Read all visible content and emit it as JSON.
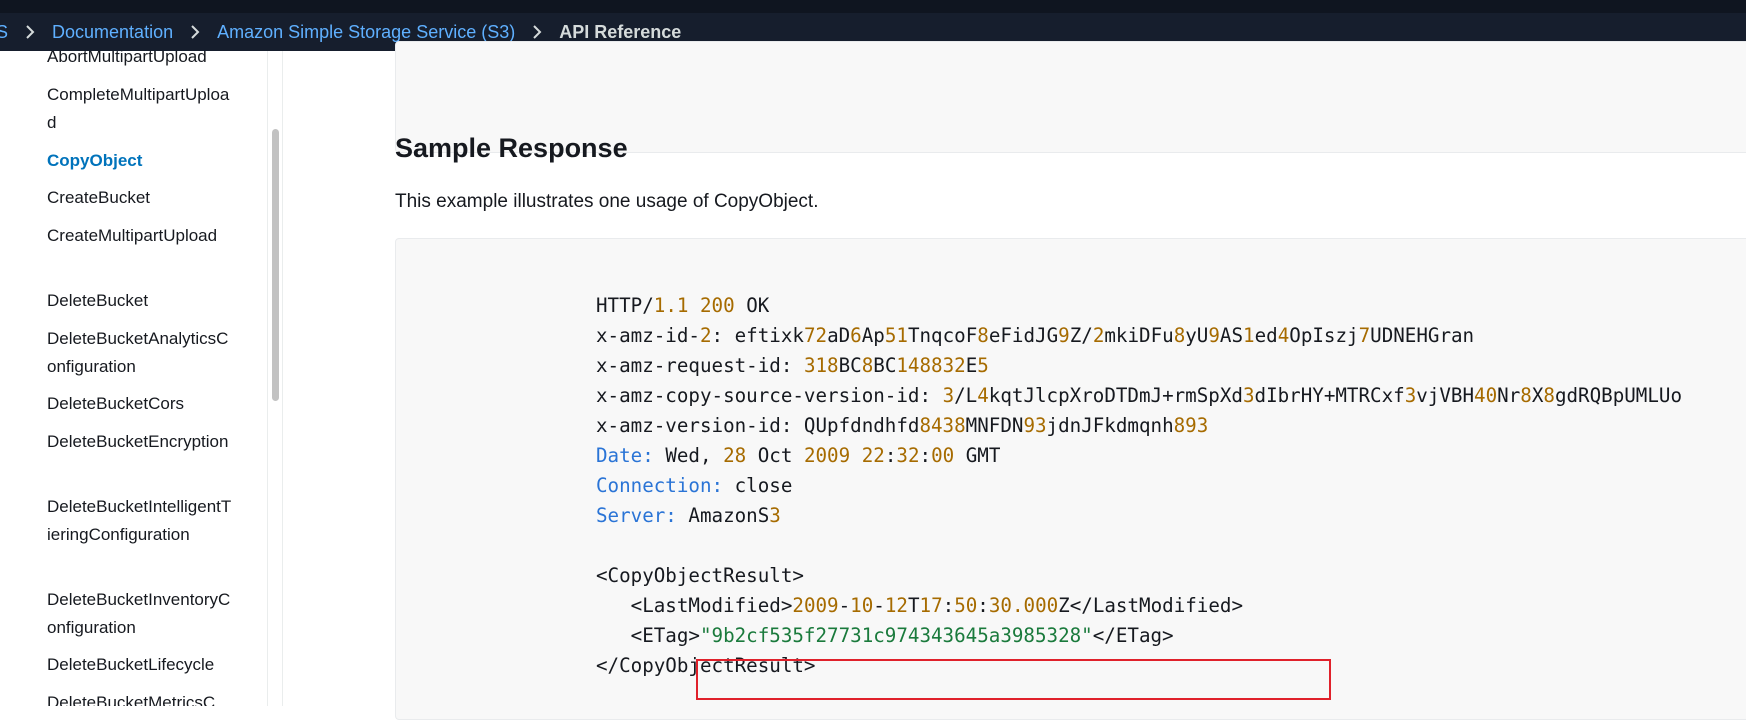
{
  "breadcrumb": {
    "items": [
      "S",
      "Documentation",
      "Amazon Simple Storage Service (S3)"
    ],
    "current": "API Reference"
  },
  "sidebar": {
    "items": [
      {
        "label": "AbortMultipartUpload",
        "active": false
      },
      {
        "label": "CompleteMultipartUpload",
        "active": false
      },
      {
        "label": "CopyObject",
        "active": true
      },
      {
        "label": "CreateBucket",
        "active": false
      },
      {
        "label": "CreateMultipartUpload",
        "active": false
      },
      {
        "label": "DeleteBucket",
        "active": false
      },
      {
        "label": "DeleteBucketAnalyticsConfiguration",
        "active": false
      },
      {
        "label": "DeleteBucketCors",
        "active": false
      },
      {
        "label": "DeleteBucketEncryption",
        "active": false
      },
      {
        "label": "DeleteBucketIntelligentTieringConfiguration",
        "active": false
      },
      {
        "label": "DeleteBucketInventoryConfiguration",
        "active": false
      },
      {
        "label": "DeleteBucketLifecycle",
        "active": false
      },
      {
        "label": "DeleteBucketMetricsC",
        "active": false
      }
    ]
  },
  "main": {
    "section_title": "Sample Response",
    "description": "This example illustrates one usage of CopyObject.",
    "code": {
      "http_line": "HTTP/1.1 200 OK",
      "id2": "x-amz-id-2: eftixk72aD6Ap51TnqcoF8eFidJG9Z/2mkiDFu8yU9AS1ed4OpIszj7UDNEHGran",
      "request_id": "x-amz-request-id: 318BC8BC148832E5",
      "copy_source_version_id": "x-amz-copy-source-version-id: 3/L4kqtJlcpXroDTDmJ+rmSpXd3dIbrHY+MTRCxf3vjVBH40Nr8X8gdRQBpUMLUo",
      "version_id": "x-amz-version-id: QUpfdndhfd8438MNFDN93jdnJFkdmqnh893",
      "date": "Date: Wed, 28 Oct 2009 22:32:00 GMT",
      "connection": "Connection: close",
      "server": "Server: AmazonS3",
      "result_open": "<CopyObjectResult>",
      "last_modified": "   <LastModified>2009-10-12T17:50:30.000Z</LastModified>",
      "etag": "   <ETag>\"9b2cf535f27731c974343645a3985328\"</ETag>",
      "result_close": "</CopyObjectResult>"
    }
  },
  "colors": {
    "topbar_bg": "#161e2d",
    "link": "#5fb0ff",
    "active_nav": "#0073bb",
    "code_number": "#a66b00",
    "code_keyword": "#2a74d6",
    "code_string": "#1a7a3c",
    "highlight_box": "#e0212b"
  },
  "icons": [
    "chevron-right-icon"
  ]
}
